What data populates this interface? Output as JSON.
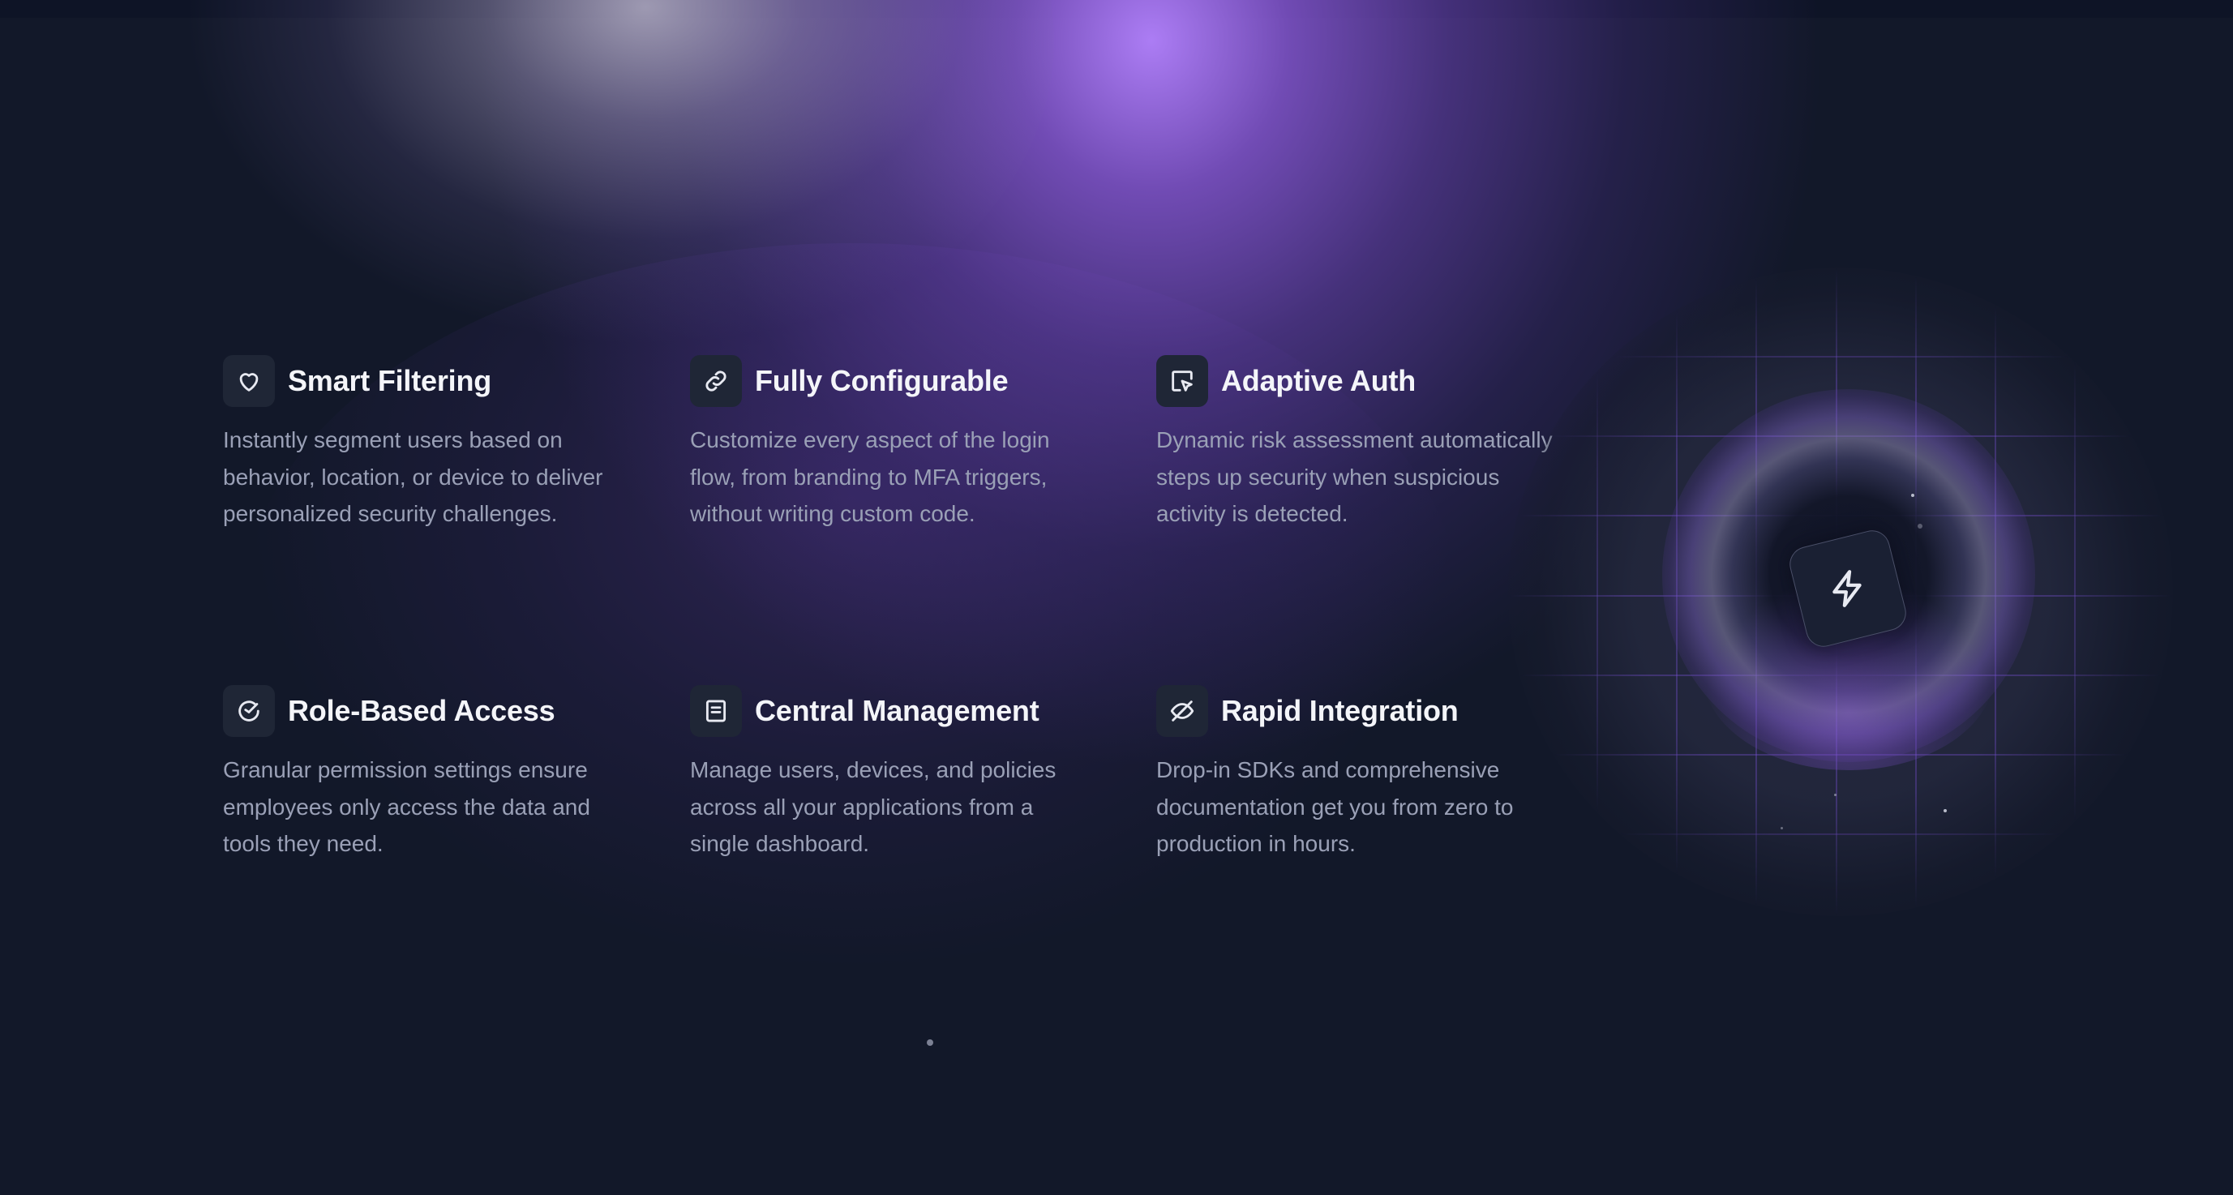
{
  "features": [
    {
      "title": "Smart Filtering",
      "description": "Instantly segment users based on behavior, location, or device to deliver personalized security challenges.",
      "icon": "heart-icon"
    },
    {
      "title": "Fully Configurable",
      "description": "Customize every aspect of the login flow, from branding to MFA triggers, without writing custom code.",
      "icon": "link-icon"
    },
    {
      "title": "Adaptive Auth",
      "description": "Dynamic risk assessment automatically steps up security when suspicious activity is detected.",
      "icon": "cursor-select-icon"
    },
    {
      "title": "Role-Based Access",
      "description": "Granular permission settings ensure employees only access the data and tools they need.",
      "icon": "gauge-check-icon"
    },
    {
      "title": "Central Management",
      "description": "Manage users, devices, and policies across all your applications from a single dashboard.",
      "icon": "document-list-icon"
    },
    {
      "title": "Rapid Integration",
      "description": "Drop-in SDKs and comprehensive documentation get you from zero to production in hours.",
      "icon": "eye-off-icon"
    }
  ],
  "hero_visual": {
    "icon": "lightning-bolt-icon",
    "accent_color": "#8b5cf6"
  },
  "colors": {
    "background": "#121829",
    "title_text": "#f4f5f9",
    "body_text": "#9aa0b6",
    "icon_box": "#1f2636"
  }
}
